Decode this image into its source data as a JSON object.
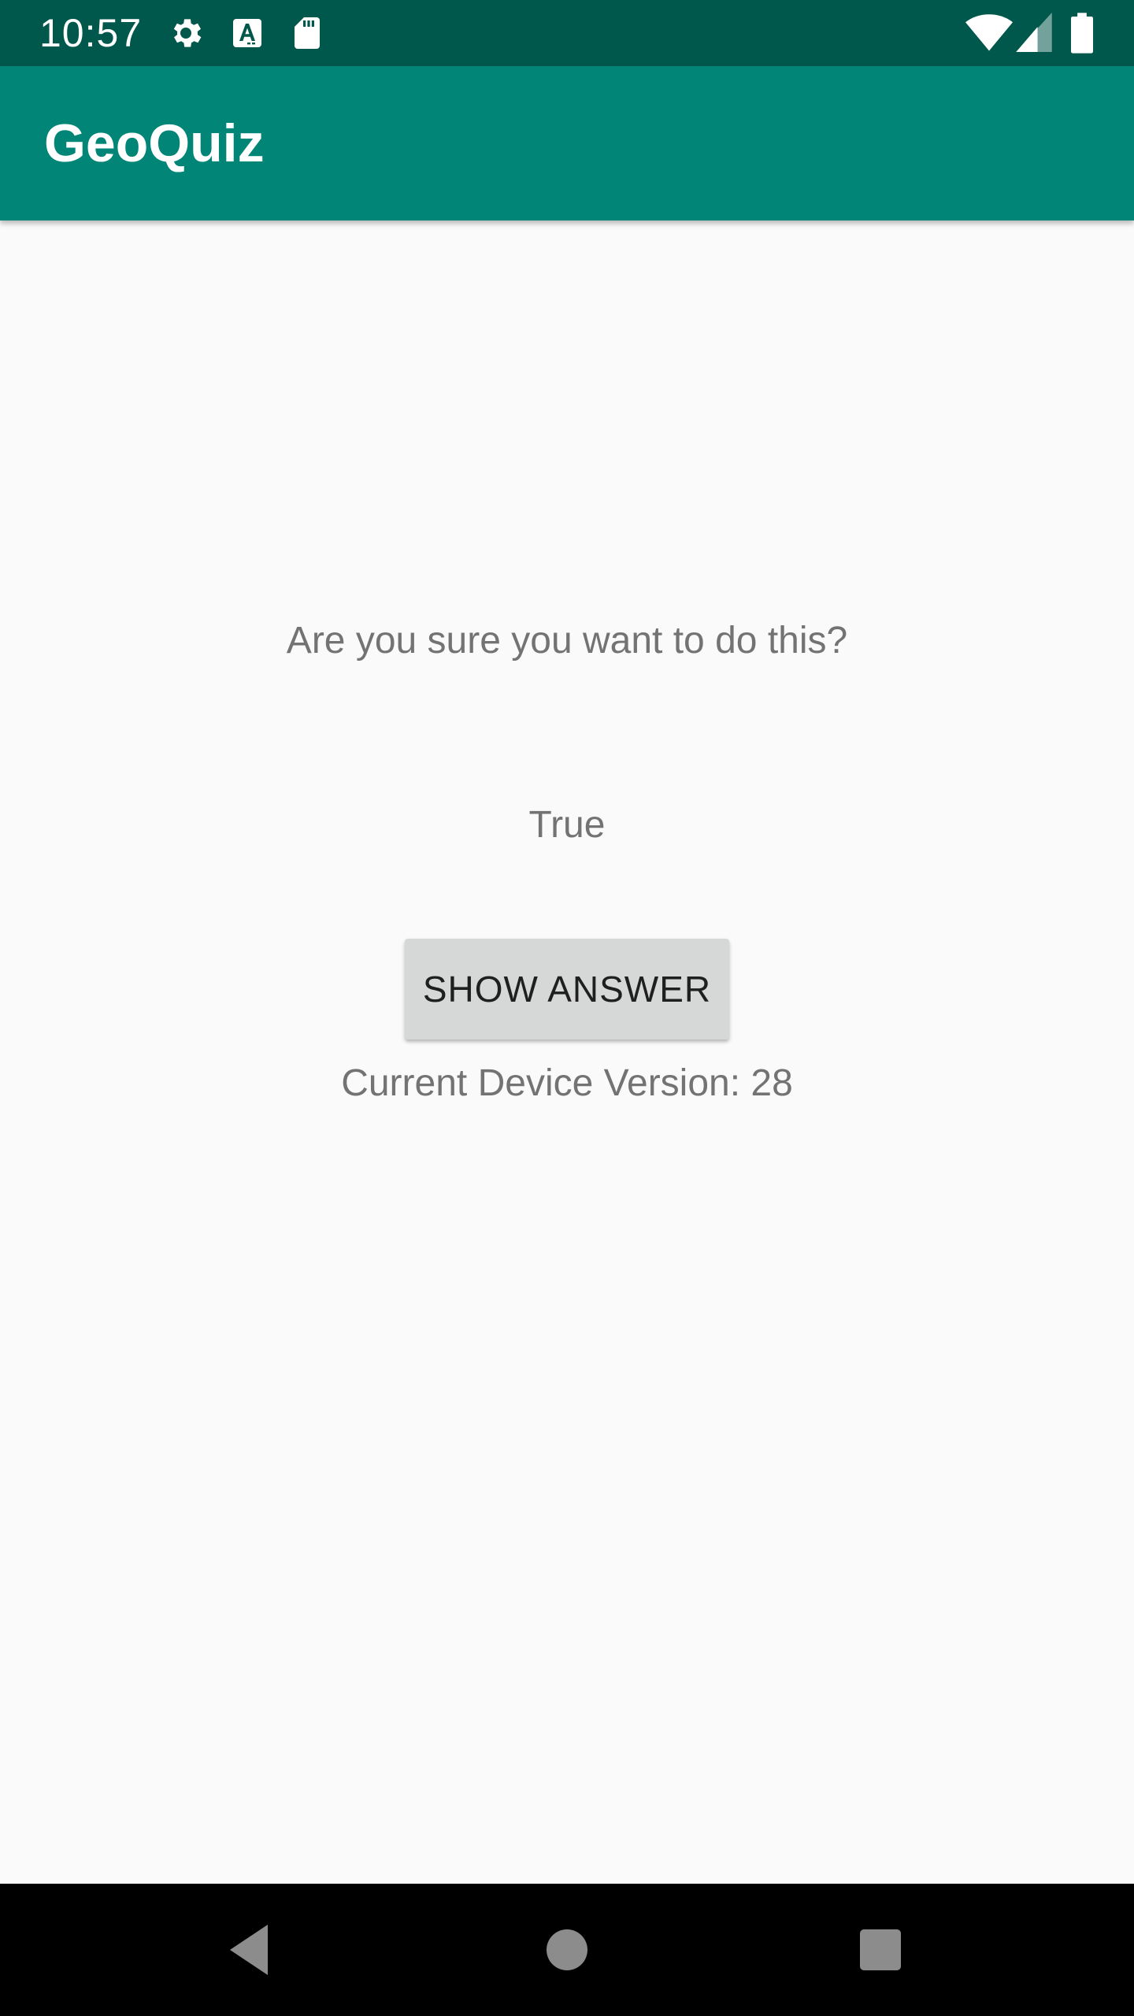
{
  "status_bar": {
    "time": "10:57",
    "icons_left": [
      "gear-icon",
      "text-a-icon",
      "sd-card-icon"
    ],
    "icons_right": [
      "wifi-icon",
      "cell-signal-icon",
      "battery-icon"
    ]
  },
  "app_bar": {
    "title": "GeoQuiz",
    "color": "#008577"
  },
  "main": {
    "question": "Are you sure you want to do this?",
    "answer": "True",
    "show_answer_label": "SHOW ANSWER",
    "device_version": "Current Device Version: 28"
  },
  "nav_bar": {
    "buttons": [
      "back-icon",
      "home-icon",
      "recents-icon"
    ]
  },
  "colors": {
    "status_bar": "#00574b",
    "app_bar": "#008577",
    "background": "#fafafa",
    "button": "#d6d7d7"
  }
}
